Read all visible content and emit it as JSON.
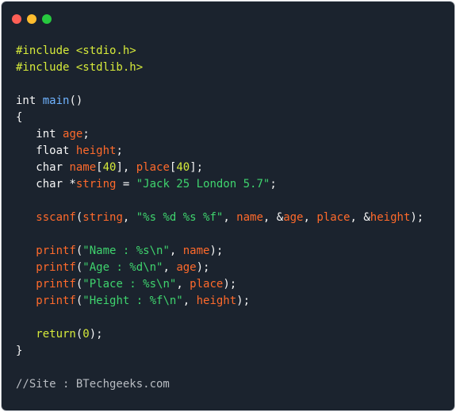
{
  "window": {
    "colors": {
      "background": "#1b232e",
      "close": "#ff5f56",
      "minimize": "#ffbd2e",
      "maximize": "#27c93f"
    }
  },
  "code": {
    "colors": {
      "preprocessor": "#d6ea3a",
      "plain": "#f5f5f5",
      "function_name": "#6fb3ff",
      "variable": "#ff6a2b",
      "number": "#d6ea3a",
      "string": "#3fd46e",
      "comment": "#b8bcc2"
    },
    "lines": [
      [
        {
          "t": "#include <stdio.h>",
          "k": "pp"
        }
      ],
      [
        {
          "t": "#include <stdlib.h>",
          "k": "pp"
        }
      ],
      [],
      [
        {
          "t": "int ",
          "k": "type"
        },
        {
          "t": "main",
          "k": "fn"
        },
        {
          "t": "()",
          "k": "plain"
        }
      ],
      [
        {
          "t": "{",
          "k": "plain"
        }
      ],
      [
        {
          "t": "   int ",
          "k": "type"
        },
        {
          "t": "age",
          "k": "var"
        },
        {
          "t": ";",
          "k": "plain"
        }
      ],
      [
        {
          "t": "   float ",
          "k": "type"
        },
        {
          "t": "height",
          "k": "var"
        },
        {
          "t": ";",
          "k": "plain"
        }
      ],
      [
        {
          "t": "   char ",
          "k": "type"
        },
        {
          "t": "name",
          "k": "var"
        },
        {
          "t": "[",
          "k": "plain"
        },
        {
          "t": "40",
          "k": "num"
        },
        {
          "t": "], ",
          "k": "plain"
        },
        {
          "t": "place",
          "k": "var"
        },
        {
          "t": "[",
          "k": "plain"
        },
        {
          "t": "40",
          "k": "num"
        },
        {
          "t": "];",
          "k": "plain"
        }
      ],
      [
        {
          "t": "   char *",
          "k": "type"
        },
        {
          "t": "string",
          "k": "var"
        },
        {
          "t": " = ",
          "k": "plain"
        },
        {
          "t": "\"Jack 25 London 5.7\"",
          "k": "str"
        },
        {
          "t": ";",
          "k": "plain"
        }
      ],
      [],
      [
        {
          "t": "   sscanf",
          "k": "call"
        },
        {
          "t": "(",
          "k": "plain"
        },
        {
          "t": "string",
          "k": "var"
        },
        {
          "t": ", ",
          "k": "plain"
        },
        {
          "t": "\"%s %d %s %f\"",
          "k": "str"
        },
        {
          "t": ", ",
          "k": "plain"
        },
        {
          "t": "name",
          "k": "var"
        },
        {
          "t": ", &",
          "k": "plain"
        },
        {
          "t": "age",
          "k": "var"
        },
        {
          "t": ", ",
          "k": "plain"
        },
        {
          "t": "place",
          "k": "var"
        },
        {
          "t": ", &",
          "k": "plain"
        },
        {
          "t": "height",
          "k": "var"
        },
        {
          "t": ");",
          "k": "plain"
        }
      ],
      [],
      [
        {
          "t": "   printf",
          "k": "call"
        },
        {
          "t": "(",
          "k": "plain"
        },
        {
          "t": "\"Name : %s\\n\"",
          "k": "str"
        },
        {
          "t": ", ",
          "k": "plain"
        },
        {
          "t": "name",
          "k": "var"
        },
        {
          "t": ");",
          "k": "plain"
        }
      ],
      [
        {
          "t": "   printf",
          "k": "call"
        },
        {
          "t": "(",
          "k": "plain"
        },
        {
          "t": "\"Age : %d\\n\"",
          "k": "str"
        },
        {
          "t": ", ",
          "k": "plain"
        },
        {
          "t": "age",
          "k": "var"
        },
        {
          "t": ");",
          "k": "plain"
        }
      ],
      [
        {
          "t": "   printf",
          "k": "call"
        },
        {
          "t": "(",
          "k": "plain"
        },
        {
          "t": "\"Place : %s\\n\"",
          "k": "str"
        },
        {
          "t": ", ",
          "k": "plain"
        },
        {
          "t": "place",
          "k": "var"
        },
        {
          "t": ");",
          "k": "plain"
        }
      ],
      [
        {
          "t": "   printf",
          "k": "call"
        },
        {
          "t": "(",
          "k": "plain"
        },
        {
          "t": "\"Height : %f\\n\"",
          "k": "str"
        },
        {
          "t": ", ",
          "k": "plain"
        },
        {
          "t": "height",
          "k": "var"
        },
        {
          "t": ");",
          "k": "plain"
        }
      ],
      [],
      [
        {
          "t": "   return",
          "k": "kw"
        },
        {
          "t": "(",
          "k": "plain"
        },
        {
          "t": "0",
          "k": "num"
        },
        {
          "t": ");",
          "k": "plain"
        }
      ],
      [
        {
          "t": "}",
          "k": "plain"
        }
      ],
      [],
      [
        {
          "t": "//Site : BTechgeeks.com",
          "k": "comment"
        }
      ]
    ]
  }
}
